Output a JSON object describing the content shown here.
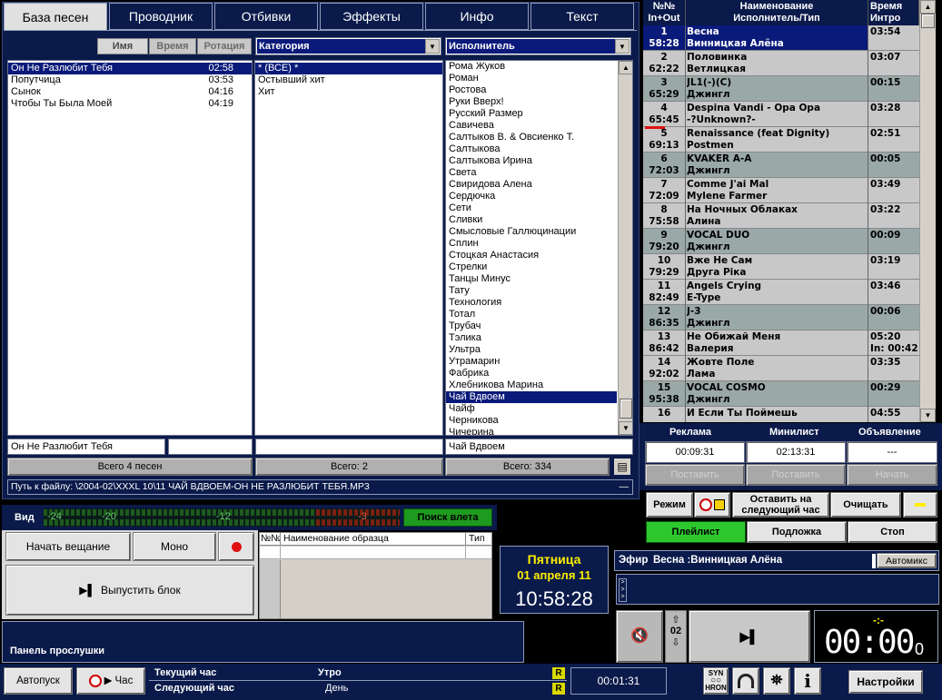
{
  "tabs": [
    "База песен",
    "Проводник",
    "Отбивки",
    "Эффекты",
    "Инфо",
    "Текст"
  ],
  "song_list": {
    "headers": {
      "name": "Имя",
      "time": "Время",
      "rotation": "Ротация"
    },
    "rows": [
      {
        "name": "Он Не Разлюбит Тебя",
        "time": "02:58",
        "selected": true
      },
      {
        "name": "Попутчица",
        "time": "03:53"
      },
      {
        "name": "Сынок",
        "time": "04:16"
      },
      {
        "name": "Чтобы Ты Была Моей",
        "time": "04:19"
      }
    ],
    "current": "Он Не Разлюбит Тебя",
    "total": "Всего 4 песен"
  },
  "category": {
    "label": "Категория",
    "items": [
      "* (ВСЕ) *",
      "Остывший хит",
      "Хит"
    ],
    "total": "Всего: 2"
  },
  "artist": {
    "label": "Исполнитель",
    "items": [
      "Рома Жуков",
      "Роман",
      "Ростова",
      "Руки Вверх!",
      "Русский Размер",
      "Савичева",
      "Салтыков В. & Овсиенко Т.",
      "Салтыкова",
      "Салтыкова Ирина",
      "Света",
      "Свиридова Алена",
      "Сердючка",
      "Сети",
      "Сливки",
      "Смысловые Галлюцинации",
      "Сплин",
      "Стоцкая Анастасия",
      "Стрелки",
      "Танцы Минус",
      "Тату",
      "Технология",
      "Тотал",
      "Трубач",
      "Тэлика",
      "Ультра",
      "Утрамарин",
      "Фабрика",
      "Хлебникова Марина",
      "Чай Вдвоем",
      "Чайф",
      "Черникова",
      "Чичерина"
    ],
    "selected": "Чай Вдвоем",
    "current": "Чай Вдвоем",
    "total": "Всего: 334"
  },
  "filepath": "Путь к файлу: \\2004-02\\XXXL 10\\11 ЧАЙ ВДВОЕМ-ОН НЕ РАЗЛЮБИТ ТЕБЯ.MP3",
  "playlist": {
    "headers": {
      "num": "№№\nIn+Out",
      "name": "Наименование\nИсполнитель/Тип",
      "time": "Время\nИнтро"
    },
    "rows": [
      {
        "n": "1",
        "t": "58:28",
        "title": "Весна",
        "sub": "Винницкая Алёна",
        "time": "03:54",
        "time2": "",
        "style": "first"
      },
      {
        "n": "2",
        "t": "62:22",
        "title": "Половинка",
        "sub": "Ветлицкая",
        "time": "03:07",
        "time2": "",
        "style": "grey"
      },
      {
        "n": "3",
        "t": "65:29",
        "title": "JL1(-)(C)",
        "sub": "Джингл",
        "time": "00:15",
        "time2": "",
        "style": "alt"
      },
      {
        "n": "4",
        "t": "65:45",
        "title": "Despina Vandi - Opa Opa",
        "sub": "-?Unknown?-",
        "time": "03:28",
        "time2": "",
        "style": "grey"
      },
      {
        "n": "5",
        "t": "69:13",
        "title": "Renaissance (feat Dignity)",
        "sub": "Postmen",
        "time": "02:51",
        "time2": "",
        "style": "grey"
      },
      {
        "n": "6",
        "t": "72:03",
        "title": "KVAKER A-A",
        "sub": "Джингл",
        "time": "00:05",
        "time2": "",
        "style": "alt"
      },
      {
        "n": "7",
        "t": "72:09",
        "title": "Comme J'ai Mal",
        "sub": "Mylene Farmer",
        "time": "03:49",
        "time2": "",
        "style": "grey"
      },
      {
        "n": "8",
        "t": "75:58",
        "title": "На Ночных Облаках",
        "sub": "Алина",
        "time": "03:22",
        "time2": "",
        "style": "grey"
      },
      {
        "n": "9",
        "t": "79:20",
        "title": "VOCAL DUO",
        "sub": "Джингл",
        "time": "00:09",
        "time2": "",
        "style": "alt"
      },
      {
        "n": "10",
        "t": "79:29",
        "title": "Вже Не Сам",
        "sub": "Друга Ріка",
        "time": "03:19",
        "time2": "",
        "style": "grey"
      },
      {
        "n": "11",
        "t": "82:49",
        "title": "Angels Crying",
        "sub": "E-Type",
        "time": "03:46",
        "time2": "",
        "style": "grey"
      },
      {
        "n": "12",
        "t": "86:35",
        "title": "J-3",
        "sub": "Джингл",
        "time": "00:06",
        "time2": "",
        "style": "alt"
      },
      {
        "n": "13",
        "t": "86:42",
        "title": "Не Обижай Меня",
        "sub": "Валерия",
        "time": "05:20",
        "time2": "In: 00:42",
        "style": "grey"
      },
      {
        "n": "14",
        "t": "92:02",
        "title": "Жовте Поле",
        "sub": "Лама",
        "time": "03:35",
        "time2": "",
        "style": "grey"
      },
      {
        "n": "15",
        "t": "95:38",
        "title": "VOCAL COSMO",
        "sub": "Джингл",
        "time": "00:29",
        "time2": "",
        "style": "alt"
      },
      {
        "n": "16",
        "t": "",
        "title": "И Если Ты Поймешь",
        "sub": "",
        "time": "04:55",
        "time2": "",
        "style": "grey"
      }
    ]
  },
  "blocks": {
    "ad": {
      "label": "Реклама",
      "time": "00:09:31",
      "btn": "Поставить"
    },
    "minilist": {
      "label": "Минилист",
      "time": "02:13:31",
      "btn": "Поставить"
    },
    "announce": {
      "label": "Объявление",
      "time": "---",
      "btn": "Начать"
    }
  },
  "controls": {
    "mode": "Режим",
    "leave": "Оставить на\nследующий час",
    "clear": "Очищать",
    "minus": "—",
    "playlist": "Плейлист",
    "background": "Подложка",
    "stop": "Стоп"
  },
  "meter": {
    "label": "Вид",
    "ticks": [
      "-24",
      "-20",
      "-12",
      "-3"
    ],
    "search": "Поиск влета"
  },
  "broadcast": {
    "start": "Начать вещание",
    "mono": "Моно",
    "release": "Выпустить блок"
  },
  "samples": {
    "col_num": "№№",
    "col_name": "Наименование образца",
    "col_type": "Тип"
  },
  "clock": {
    "day": "Пятница",
    "date": "01 апреля 11",
    "time": "10:58:28"
  },
  "air": {
    "label": "Эфир",
    "text": "Весна :Винницкая Алёна",
    "automix": "Автомикс"
  },
  "player": {
    "counter": "02",
    "timer": "00:00",
    "timer_frac": "0",
    "dash": "-:-"
  },
  "listen": {
    "label": "Панель прослушки"
  },
  "bottom": {
    "autostart": "Автопуск",
    "hour": "Час",
    "current_hour_label": "Текущий час",
    "current_hour_value": "Утро",
    "next_hour_label": "Следующий час",
    "next_hour_value": "День",
    "r1": "R",
    "r2": "R",
    "elapsed": "00:01:31",
    "sync_top": "SYN",
    "sync_bottom": "HRON",
    "info": "i",
    "settings": "Настройки"
  }
}
